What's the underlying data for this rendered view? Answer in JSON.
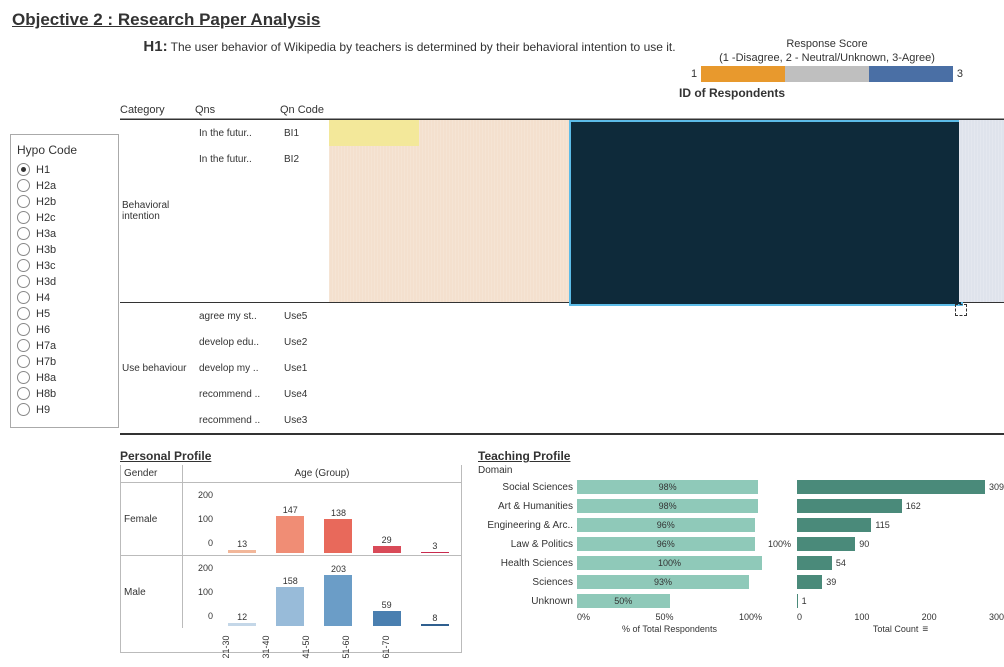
{
  "title": "Objective 2 : Research Paper Analysis",
  "hypothesis": {
    "label": "H1:",
    "text": "The user behavior of Wikipedia by teachers is determined by their behavioral intention to use it."
  },
  "legend": {
    "title": "Response Score",
    "sub": "(1 -Disagree, 2 - Neutral/Unknown, 3-Agree)",
    "low": "1",
    "high": "3",
    "colors": [
      "#e8992d",
      "#bfbfbf",
      "#4a6fa5"
    ]
  },
  "hypo": {
    "title": "Hypo Code",
    "options": [
      "H1",
      "H2a",
      "H2b",
      "H2c",
      "H3a",
      "H3b",
      "H3c",
      "H3d",
      "H4",
      "H5",
      "H6",
      "H7a",
      "H7b",
      "H8a",
      "H8b",
      "H9"
    ],
    "selected": "H1"
  },
  "heatmap": {
    "title": "ID of Respondents",
    "headers": {
      "category": "Category",
      "qns": "Qns",
      "code": "Qn Code"
    },
    "groups": [
      {
        "category": "Behavioral intention",
        "rows": [
          {
            "qns": "In the futur..",
            "code": "BI1"
          },
          {
            "qns": "In the futur..",
            "code": "BI2"
          }
        ]
      },
      {
        "category": "Use behaviour",
        "rows": [
          {
            "qns": "agree my st..",
            "code": "Use5"
          },
          {
            "qns": "develop edu..",
            "code": "Use2"
          },
          {
            "qns": "develop my ..",
            "code": "Use1"
          },
          {
            "qns": "recommend ..",
            "code": "Use4"
          },
          {
            "qns": "recommend ..",
            "code": "Use3"
          }
        ]
      }
    ]
  },
  "personal": {
    "title": "Personal Profile",
    "gender_h": "Gender",
    "age_h": "Age (Group)",
    "scale": [
      "200",
      "100",
      "0"
    ],
    "xcats": [
      "21-30",
      "31-40",
      "41-50",
      "51-60",
      "61-70"
    ]
  },
  "teaching": {
    "title": "Teaching Profile",
    "domain_h": "Domain",
    "xlabel": "% of Total Respondents",
    "xlabel2": "Total Count",
    "ref": "100%",
    "pct_ticks": [
      "0%",
      "50%",
      "100%"
    ],
    "cnt_ticks": [
      "0",
      "100",
      "200",
      "300"
    ]
  },
  "chart_data": {
    "personal_profile": {
      "type": "bar",
      "categories": [
        "21-30",
        "31-40",
        "41-50",
        "51-60",
        "61-70"
      ],
      "series": [
        {
          "name": "Female",
          "values": [
            13,
            147,
            138,
            29,
            3
          ],
          "colors": [
            "#f2b79a",
            "#f08d75",
            "#e8695b",
            "#d94a58",
            "#c82a4e"
          ]
        },
        {
          "name": "Male",
          "values": [
            12,
            158,
            203,
            59,
            8
          ],
          "colors": [
            "#c4d7e8",
            "#98bbd9",
            "#6b9dc7",
            "#4a7fb0",
            "#2f5f8f"
          ]
        }
      ],
      "ylim": [
        0,
        220
      ]
    },
    "teaching_profile": {
      "type": "bar",
      "domains": [
        "Social Sciences",
        "Art & Humanities",
        "Engineering & Arc..",
        "Law & Politics",
        "Health Sciences",
        "Sciences",
        "Unknown"
      ],
      "pct": [
        98,
        98,
        96,
        96,
        100,
        93,
        50
      ],
      "count": [
        309,
        162,
        115,
        90,
        54,
        39,
        1
      ]
    }
  }
}
